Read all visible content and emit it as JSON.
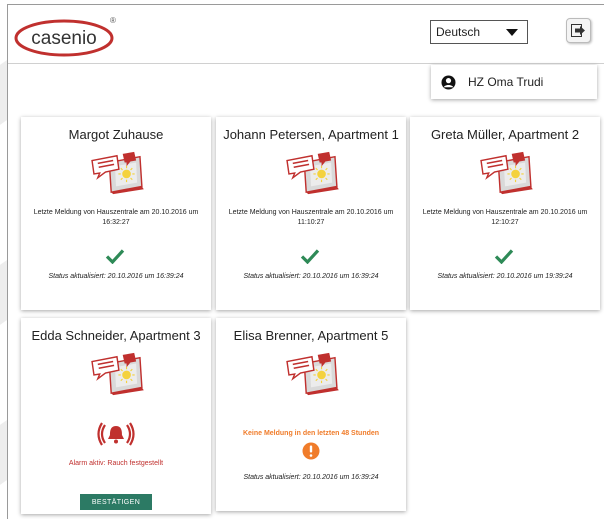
{
  "header": {
    "logo_text": "casenio",
    "logo_mark": "®",
    "language": "Deutsch",
    "user_name": "HZ Oma Trudi"
  },
  "cards": [
    {
      "name": "Margot Zuhause",
      "message": "Letzte Meldung von Hauszentrale am 20.10.2016 um 16:32:27",
      "updated": "Status aktualisiert: 20.10.2016 um 16:39:24"
    },
    {
      "name": "Johann Petersen, Apartment 1",
      "message": "Letzte Meldung von Hauszentrale am 20.10.2016 um 11:10:27",
      "updated": "Status aktualisiert: 20.10.2016 um 16:39:24"
    },
    {
      "name": "Greta Müller, Apartment 2",
      "message": "Letzte Meldung von Hauszentrale am 20.10.2016 um 12:10:27",
      "updated": "Status aktualisiert: 20.10.2016 um 19:39:24"
    },
    {
      "name": "Edda Schneider, Apartment 3",
      "alarm": "Alarm aktiv: Rauch festgestellt",
      "confirm_label": "BESTÄTIGEN"
    },
    {
      "name": "Elisa Brenner, Apartment 5",
      "warning": "Keine Meldung in den letzten 48 Stunden",
      "updated": "Status aktualisiert: 20.10.2016 um 16:39:24"
    }
  ],
  "colors": {
    "brand_red": "#c0302e",
    "ok_green": "#2e8a57",
    "warning_orange": "#f07c2a",
    "confirm_button": "#2c7a64"
  },
  "icons": [
    "logout-icon",
    "user-icon",
    "device-icon",
    "check-icon",
    "alarm-bell-icon",
    "warning-icon",
    "dropdown-arrow-icon"
  ]
}
